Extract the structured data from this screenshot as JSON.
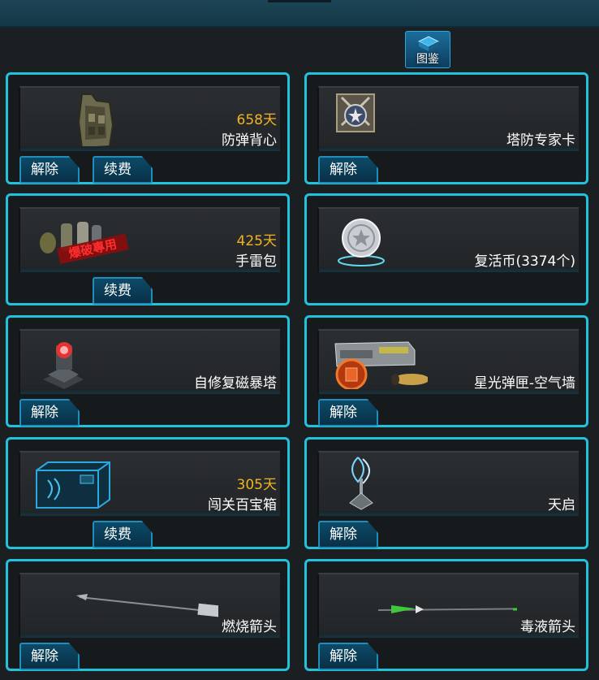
{
  "toolbar": {
    "codex_label": "图鉴"
  },
  "items": [
    {
      "name": "防弹背心",
      "days": "658天",
      "release": "解除",
      "renew": "续费",
      "icon": "bulletproof-vest-icon"
    },
    {
      "name": "塔防专家卡",
      "days": "",
      "release": "解除",
      "renew": "",
      "icon": "tower-defense-card-icon"
    },
    {
      "name": "手雷包",
      "days": "425天",
      "release": "",
      "renew": "续费",
      "icon": "grenade-pack-icon",
      "stamp": "爆破專用"
    },
    {
      "name": "复活币(3374个)",
      "days": "",
      "release": "",
      "renew": "",
      "icon": "revive-coin-icon"
    },
    {
      "name": "自修复磁暴塔",
      "days": "",
      "release": "解除",
      "renew": "",
      "icon": "tesla-tower-icon"
    },
    {
      "name": "星光弹匣-空气墙",
      "days": "",
      "release": "解除",
      "renew": "",
      "icon": "magazine-icon"
    },
    {
      "name": "闯关百宝箱",
      "days": "305天",
      "release": "",
      "renew": "续费",
      "icon": "treasure-chest-icon"
    },
    {
      "name": "天启",
      "days": "",
      "release": "解除",
      "renew": "",
      "icon": "apocalypse-icon"
    },
    {
      "name": "燃烧箭头",
      "days": "",
      "release": "解除",
      "renew": "",
      "icon": "fire-arrow-icon"
    },
    {
      "name": "毒液箭头",
      "days": "",
      "release": "解除",
      "renew": "",
      "icon": "venom-arrow-icon"
    }
  ]
}
